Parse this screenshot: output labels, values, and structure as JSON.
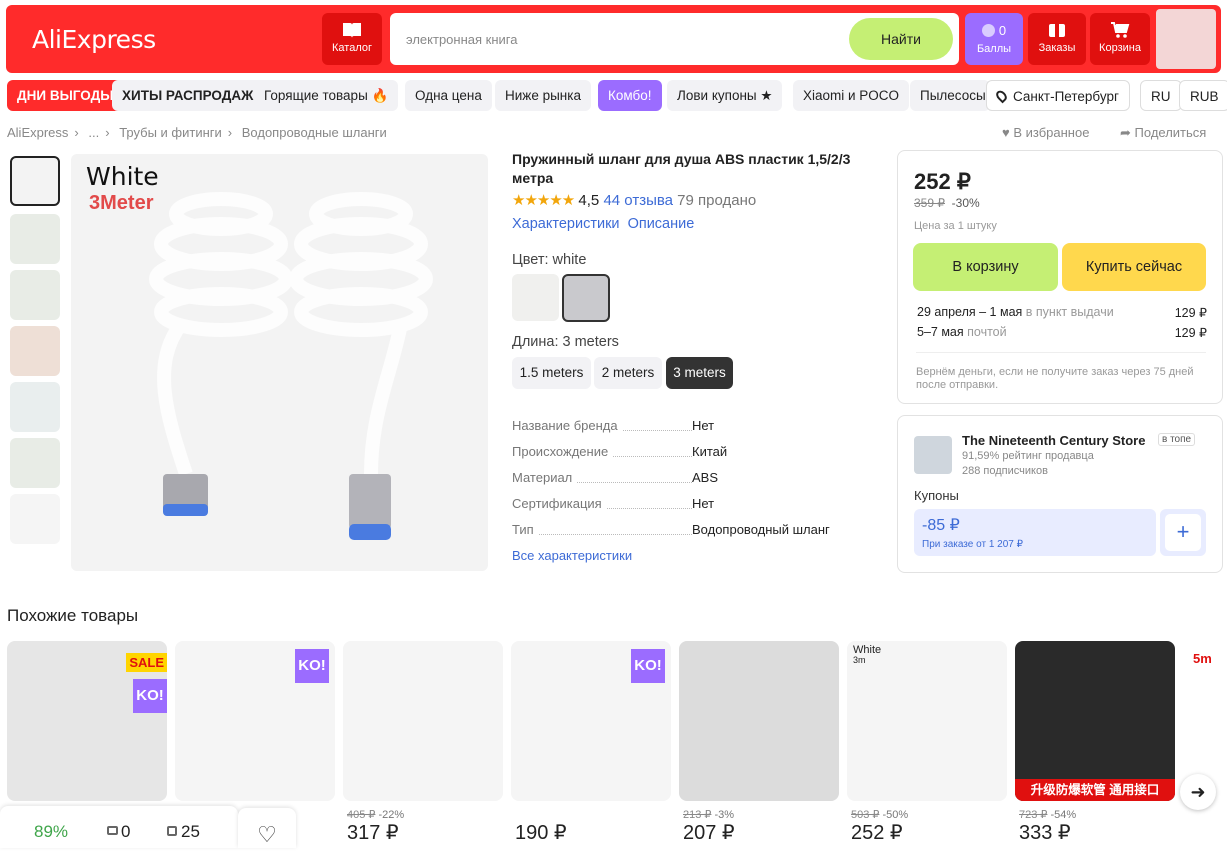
{
  "header": {
    "logo": "AliExpress",
    "catalog": "Каталог",
    "search_placeholder": "электронная книга",
    "search_button": "Найти",
    "points_count": "0",
    "points_label": "Баллы",
    "orders": "Заказы",
    "cart": "Корзина"
  },
  "nav": {
    "pills": [
      "ДНИ ВЫГОДЫ",
      "ХИТЫ РАСПРОДАЖИ",
      "Горящие товары 🔥",
      "Одна цена",
      "Ниже рынка",
      "Комбо!",
      "Лови купоны ★",
      "Xiaomi и POCO",
      "Пылесосы"
    ],
    "city": "Санкт-Петербург",
    "lang": "RU",
    "currency": "RUB"
  },
  "breadcrumb": [
    "AliExpress",
    "...",
    "Трубы и фитинги",
    "Водопроводные шланги"
  ],
  "actions": {
    "favorite": "В избранное",
    "share": "Поделиться"
  },
  "image": {
    "line1": "White",
    "line2": "3Meter"
  },
  "product": {
    "title": "Пружинный шланг для душа ABS пластик 1,5/2/3 метра",
    "rating": "4,5",
    "reviews": "44 отзыва",
    "sold": "79 продано",
    "tab_chars": "Характеристики",
    "tab_desc": "Описание",
    "color_label": "Цвет: white",
    "length_label": "Длина: 3 meters",
    "lengths": [
      "1.5 meters",
      "2 meters",
      "3 meters"
    ],
    "specs": [
      {
        "k": "Название бренда",
        "v": "Нет"
      },
      {
        "k": "Происхождение",
        "v": "Китай"
      },
      {
        "k": "Материал",
        "v": "ABS"
      },
      {
        "k": "Сертификация",
        "v": "Нет"
      },
      {
        "k": "Тип",
        "v": "Водопроводный шланг"
      }
    ],
    "all_specs": "Все характеристики"
  },
  "buy": {
    "price": "252 ₽",
    "old_price": "359 ₽",
    "discount": "-30%",
    "unit": "Цена за 1 штуку",
    "add_to_cart": "В корзину",
    "buy_now": "Купить сейчас",
    "delivery": [
      {
        "date": "29 апреля – 1 мая",
        "method": "в пункт выдачи",
        "price": "129 ₽"
      },
      {
        "date": "5–7 мая",
        "method": "почтой",
        "price": "129 ₽"
      }
    ],
    "guarantee": "Вернём деньги, если не получите заказ через 75 дней после отправки."
  },
  "store": {
    "name": "The Nineteenth Century Store",
    "badge": "в топе",
    "rating": "91,59% рейтинг продавца",
    "subscribers": "288 подписчиков",
    "coupons_label": "Купоны",
    "coupon_amount": "-85 ₽",
    "coupon_cond": "При заказе от 1 207 ₽"
  },
  "similar": {
    "heading": "Похожие товары",
    "items": [
      {
        "price": "",
        "old": "",
        "disc": "",
        "badge": "SALE"
      },
      {
        "price": "",
        "old": "",
        "disc": "",
        "badge": "KO!"
      },
      {
        "price": "317 ₽",
        "old": "405 ₽",
        "disc": "-22%",
        "badge": ""
      },
      {
        "price": "190 ₽",
        "old": "",
        "disc": "",
        "badge": "KO!"
      },
      {
        "price": "207 ₽",
        "old": "213 ₽",
        "disc": "-3%",
        "badge": ""
      },
      {
        "price": "252 ₽",
        "old": "503 ₽",
        "disc": "-50%",
        "badge": ""
      },
      {
        "price": "333 ₽",
        "old": "723 ₽",
        "disc": "-54%",
        "badge": ""
      }
    ],
    "item6_text": "White",
    "item6_sub": "3m",
    "item7_banner": "升级防爆软管 通用接口",
    "item8_text": "5m"
  },
  "bottombar": {
    "percent": "89%",
    "photos": "0",
    "copies": "25"
  }
}
